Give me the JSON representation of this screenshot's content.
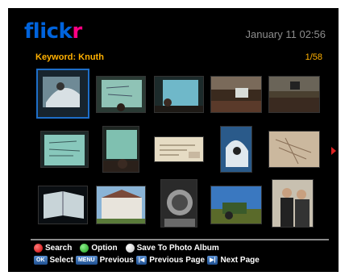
{
  "header": {
    "logo_part1": "flick",
    "logo_part2": "r",
    "datetime": "January 11 02:56"
  },
  "search": {
    "keyword": "Keyword: Knuth",
    "page_indicator": "1/58"
  },
  "thumbnails": [
    {
      "label": "photo-1",
      "selected": true
    },
    {
      "label": "photo-2"
    },
    {
      "label": "photo-3"
    },
    {
      "label": "photo-4"
    },
    {
      "label": "photo-5"
    },
    {
      "label": "photo-6"
    },
    {
      "label": "photo-7"
    },
    {
      "label": "photo-8"
    },
    {
      "label": "photo-9"
    },
    {
      "label": "photo-10"
    },
    {
      "label": "photo-11"
    },
    {
      "label": "photo-12"
    },
    {
      "label": "photo-13"
    },
    {
      "label": "photo-14"
    },
    {
      "label": "photo-15"
    }
  ],
  "legend": {
    "search_label": "Search",
    "option_label": "Option",
    "save_label": "Save To Photo Album",
    "ok_key": "OK",
    "select_label": "Select",
    "menu_key": "MENU",
    "previous_label": "Previous",
    "prev_page_key": "|◀",
    "previous_page_label": "Previous Page",
    "next_page_key": "▶|",
    "next_page_label": "Next Page"
  },
  "colors": {
    "logo_blue": "#0063dc",
    "logo_pink": "#ff0084",
    "keyword_orange": "#ffb000",
    "selection_blue": "#1e6ec8"
  }
}
